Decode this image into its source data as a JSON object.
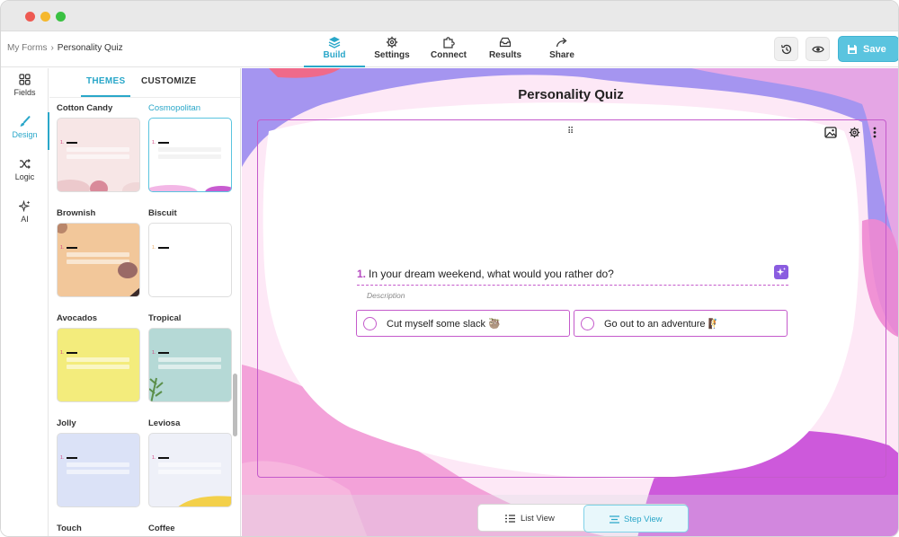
{
  "breadcrumb": {
    "parent": "My Forms",
    "separator": "›",
    "current": "Personality Quiz"
  },
  "nav_tabs": [
    {
      "label": "Build",
      "icon": "layers-icon",
      "active": true
    },
    {
      "label": "Settings",
      "icon": "gear-icon",
      "active": false
    },
    {
      "label": "Connect",
      "icon": "puzzle-icon",
      "active": false
    },
    {
      "label": "Results",
      "icon": "inbox-icon",
      "active": false
    },
    {
      "label": "Share",
      "icon": "share-arrow-icon",
      "active": false
    }
  ],
  "actions": {
    "history_icon": "history-icon",
    "preview_icon": "eye-icon",
    "save_label": "Save",
    "save_icon": "floppy-icon"
  },
  "rail": [
    {
      "label": "Fields",
      "icon": "grid-icon",
      "active": false
    },
    {
      "label": "Design",
      "icon": "brush-icon",
      "active": true
    },
    {
      "label": "Logic",
      "icon": "shuffle-icon",
      "active": false
    },
    {
      "label": "AI",
      "icon": "sparkle-icon",
      "active": false
    }
  ],
  "panel_tabs": {
    "themes": "THEMES",
    "customize": "CUSTOMIZE",
    "active": "themes"
  },
  "themes": [
    {
      "name": "Cotton Candy",
      "bg": "#f7e6e6",
      "accent": "#d98a9a",
      "selected": false
    },
    {
      "name": "Cosmopolitan",
      "bg": "#ffffff",
      "accent": "#c85bd0",
      "selected": true
    },
    {
      "name": "Brownish",
      "bg": "#f2c79a",
      "accent": "#9a6a66",
      "selected": false
    },
    {
      "name": "Biscuit",
      "bg": "#ffffff",
      "accent": "#e6a45b",
      "selected": false
    },
    {
      "name": "Avocados",
      "bg": "#f3ec7c",
      "accent": "#d9d66a",
      "selected": false
    },
    {
      "name": "Tropical",
      "bg": "#b5d9d6",
      "accent": "#5b8f4a",
      "selected": false
    },
    {
      "name": "Jolly",
      "bg": "#dbe2f7",
      "accent": "#c8d3f2",
      "selected": false
    },
    {
      "name": "Leviosa",
      "bg": "#eef0f8",
      "accent": "#f3d04a",
      "selected": false
    },
    {
      "name": "Touch",
      "bg": "#ffffff",
      "accent": "#cccccc",
      "selected": false
    },
    {
      "name": "Coffee",
      "bg": "#ffffff",
      "accent": "#cccccc",
      "selected": false
    }
  ],
  "form": {
    "title": "Personality Quiz",
    "question_number": "1.",
    "question": "In your dream weekend, what would you rather do?",
    "description_placeholder": "Description",
    "choices": [
      "Cut myself some slack 🦥",
      "Go out to an adventure 🧗"
    ],
    "card_icons": [
      "image-icon",
      "gear-icon",
      "more-vertical-icon"
    ]
  },
  "view_toggle": {
    "list": "List View",
    "step": "Step View",
    "active": "step"
  },
  "colors": {
    "accent": "#2aa7c9",
    "save": "#5ac4df",
    "question_border": "#c45acb",
    "blob_purple": "#7d6fe6",
    "blob_pink": "#ee88d2",
    "blob_violet": "#c43fd6"
  }
}
